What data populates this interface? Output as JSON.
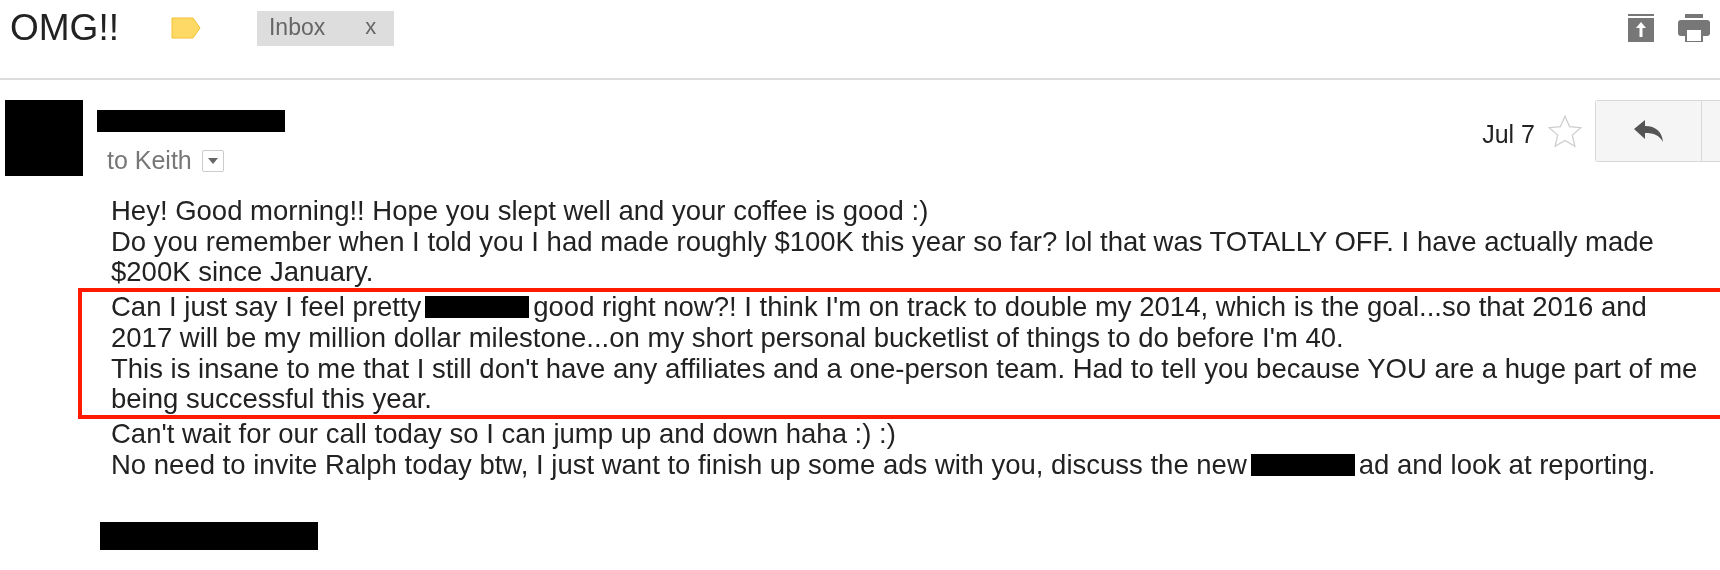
{
  "subject": "OMG!!",
  "label_chip": {
    "text": "Inbox",
    "remove": "x"
  },
  "message": {
    "recipient": "to Keith",
    "date": "Jul 7",
    "starred": false
  },
  "body": [
    {
      "kind": "paragraph",
      "text": "Hey! Good morning!! Hope you slept well and your coffee is good :)"
    },
    {
      "kind": "paragraph",
      "text": "Do you remember when I told you I had made roughly $100K this year so far? lol that was TOTALLY OFF. I have actually made $200K since January."
    },
    {
      "kind": "highlight",
      "paragraphs": [
        {
          "kind": "redacted",
          "lines": [
            [
              {
                "kind": "text",
                "text": "Can I just say I feel pretty"
              },
              {
                "kind": "redaction"
              },
              {
                "kind": "text",
                "text": "good right now?! I think I'm on track to double my 2014, which is the goal...so that 2016 and"
              }
            ],
            [
              {
                "kind": "text",
                "text": "2017 will be my million dollar milestone...on my short personal bucketlist of things to do before I'm 40."
              }
            ]
          ]
        },
        {
          "kind": "paragraph",
          "text": "This is insane to me that I still don't have any affiliates and a one-person team. Had to tell you because YOU are a huge part of me being successful this year."
        }
      ]
    },
    {
      "kind": "paragraph",
      "text": "Can't wait for our call today so I can jump up and down haha :) :)"
    },
    {
      "kind": "redacted",
      "lines": [
        [
          {
            "kind": "text",
            "text": "No need to invite Ralph today btw, I just want to finish up some ads with you, discuss the new"
          },
          {
            "kind": "redaction"
          },
          {
            "kind": "text",
            "text": "ad and look at reporting."
          }
        ]
      ]
    }
  ]
}
